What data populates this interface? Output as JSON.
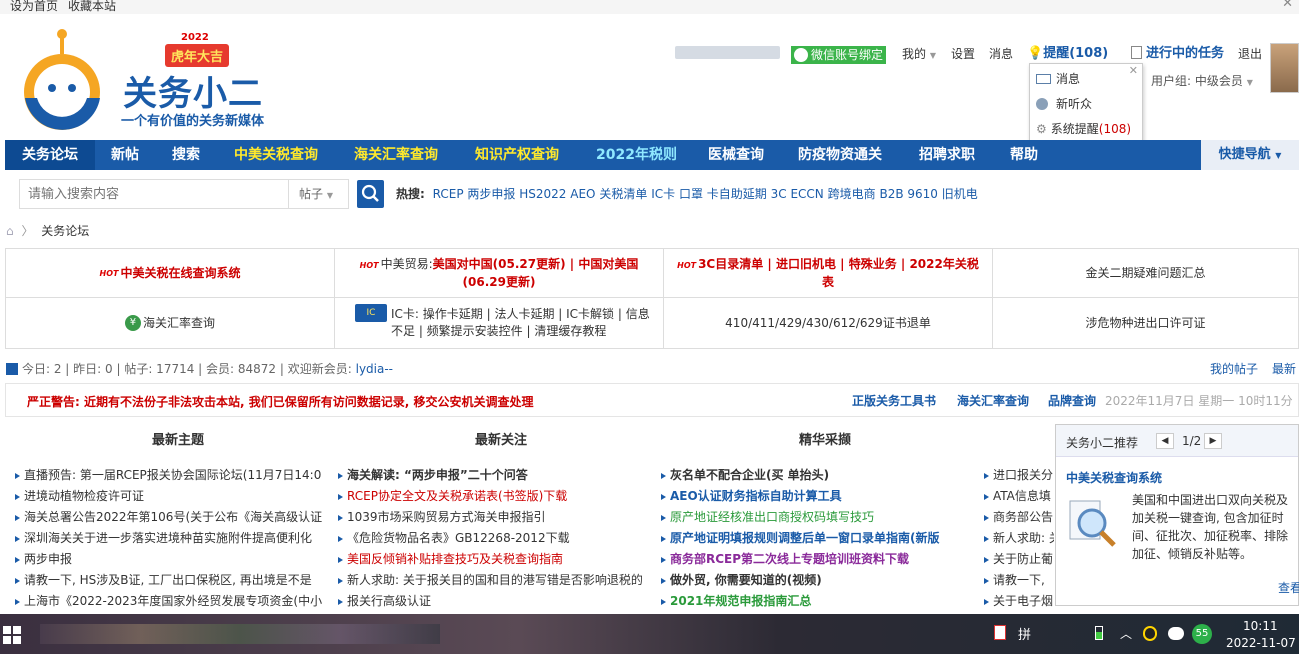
{
  "topbar": {
    "set_home": "设为首页",
    "bookmark": "收藏本站",
    "close": "✕"
  },
  "logo": {
    "year": "2022",
    "badge": "虎年大吉",
    "name": "关务小二",
    "slogan": "一个有价值的关务新媒体"
  },
  "user_bar": {
    "wechat": "微信账号绑定",
    "mine": "我的",
    "settings": "设置",
    "messages": "消息",
    "reminder": "提醒(108)",
    "tasks": "进行中的任务",
    "logout": "退出",
    "group": "用户组: 中级会员"
  },
  "popup": {
    "items": [
      {
        "label": "消息"
      },
      {
        "label": "新听众"
      },
      {
        "label": "系统提醒",
        "count": "(108)"
      }
    ]
  },
  "nav": {
    "items": [
      "关务论坛",
      "新帖",
      "搜索",
      "中美关税查询",
      "海关汇率查询",
      "知识产权查询",
      "2022年税则",
      "医械查询",
      "防疫物资通关",
      "招聘求职",
      "帮助"
    ],
    "quick": "快捷导航"
  },
  "search": {
    "placeholder": "请输入搜索内容",
    "scope": "帖子",
    "hot_label": "热搜:",
    "hot": [
      "RCEP",
      "两步申报",
      "HS2022",
      "AEO",
      "关税清单",
      "IC卡",
      "口罩",
      "卡自助延期",
      "3C",
      "ECCN",
      "跨境电商",
      "B2B",
      "9610",
      "旧机电"
    ]
  },
  "breadcrumb": {
    "current": "关务论坛"
  },
  "grid": {
    "c1": "中美关税在线查询系统",
    "c2_prefix": "中美贸易:",
    "c2": "美国对中国(05.27更新) | 中国对美国(06.29更新)",
    "c3": "3C目录清单 | 进口旧机电 | 特殊业务 | 2022年关税表",
    "c4": "金关二期疑难问题汇总",
    "c5": "海关汇率查询",
    "c6": "IC卡: 操作卡延期 | 法人卡延期 | IC卡解锁 | 信息不足 | 频繁提示安装控件 | 清理缓存教程",
    "c7": "410/411/429/430/612/629证书退单",
    "c8": "涉危物种进出口许可证",
    "hot_tag": "HOT"
  },
  "stats": {
    "text": "今日: 2 | 昨日: 0 | 帖子: 17714 | 会员: 84872 | 欢迎新会员:",
    "new_member": "lydia--",
    "my_posts": "我的帖子",
    "latest": "最新"
  },
  "warning": {
    "text": "严正警告: 近期有不法份子非法攻击本站, 我们已保留所有访问数据记录, 移交公安机关调查处理",
    "links": [
      "正版关务工具书",
      "海关汇率查询",
      "品牌查询"
    ],
    "date": "2022年11月7日 星期一 10时11分"
  },
  "columns": {
    "titles": [
      "最新主题",
      "最新关注",
      "精华采撷"
    ],
    "topics": [
      "直播预告: 第一届RCEP报关协会国际论坛(11月7日14:0",
      "进境动植物检疫许可证",
      "海关总署公告2022年第106号(关于公布《海关高级认证",
      "深圳海关关于进一步落实进境种苗实施附件提高便利化",
      "两步申报",
      "请教一下, HS涉及B证, 工厂出口保税区, 再出境是不是",
      "上海市《2022-2023年度国家外经贸发展专项资金(中小"
    ],
    "focus": [
      "海关解读: “两步申报”二十个问答",
      "RCEP协定全文及关税承诺表(书签版)下载",
      "1039市场采购贸易方式海关申报指引",
      "《危险货物品名表》GB12268-2012下载",
      "美国反倾销补贴排查技巧及关税查询指南",
      "新人求助: 关于报关目的国和目的港写错是否影响退税的",
      "报关行高级认证"
    ],
    "essence": [
      "灰名单不配合企业(买 单抬头)",
      "AEO认证财务指标自助计算工具",
      "原产地证经核准出口商授权码填写技巧",
      "原产地证明填报规则调整后单一窗口录单指南(新版",
      "商务部RCEP第二次线上专题培训班资料下载",
      "做外贸, 你需要知道的(视频)",
      "2021年规范申报指南汇总"
    ],
    "extra": [
      "进口报关分",
      "ATA信息填",
      "商务部公告",
      "新人求助: 关",
      "关于防止葡",
      "请教一下,",
      "关于电子烟"
    ]
  },
  "panel": {
    "title": "关务小二推荐",
    "page": "1/2",
    "item_title": "中美关税查询系统",
    "item_desc": "美国和中国进出口双向关税及加关税一键查询, 包含加征时间、征批次、加征税率、排除加征、倾销反补贴等。",
    "more": "查看"
  },
  "taskbar": {
    "time": "10:11",
    "date": "2022-11-07",
    "badge": "55"
  },
  "colors": {
    "nav": "#1a5ba8",
    "accent_red": "#cc0000",
    "yellow": "#ffe92c"
  }
}
